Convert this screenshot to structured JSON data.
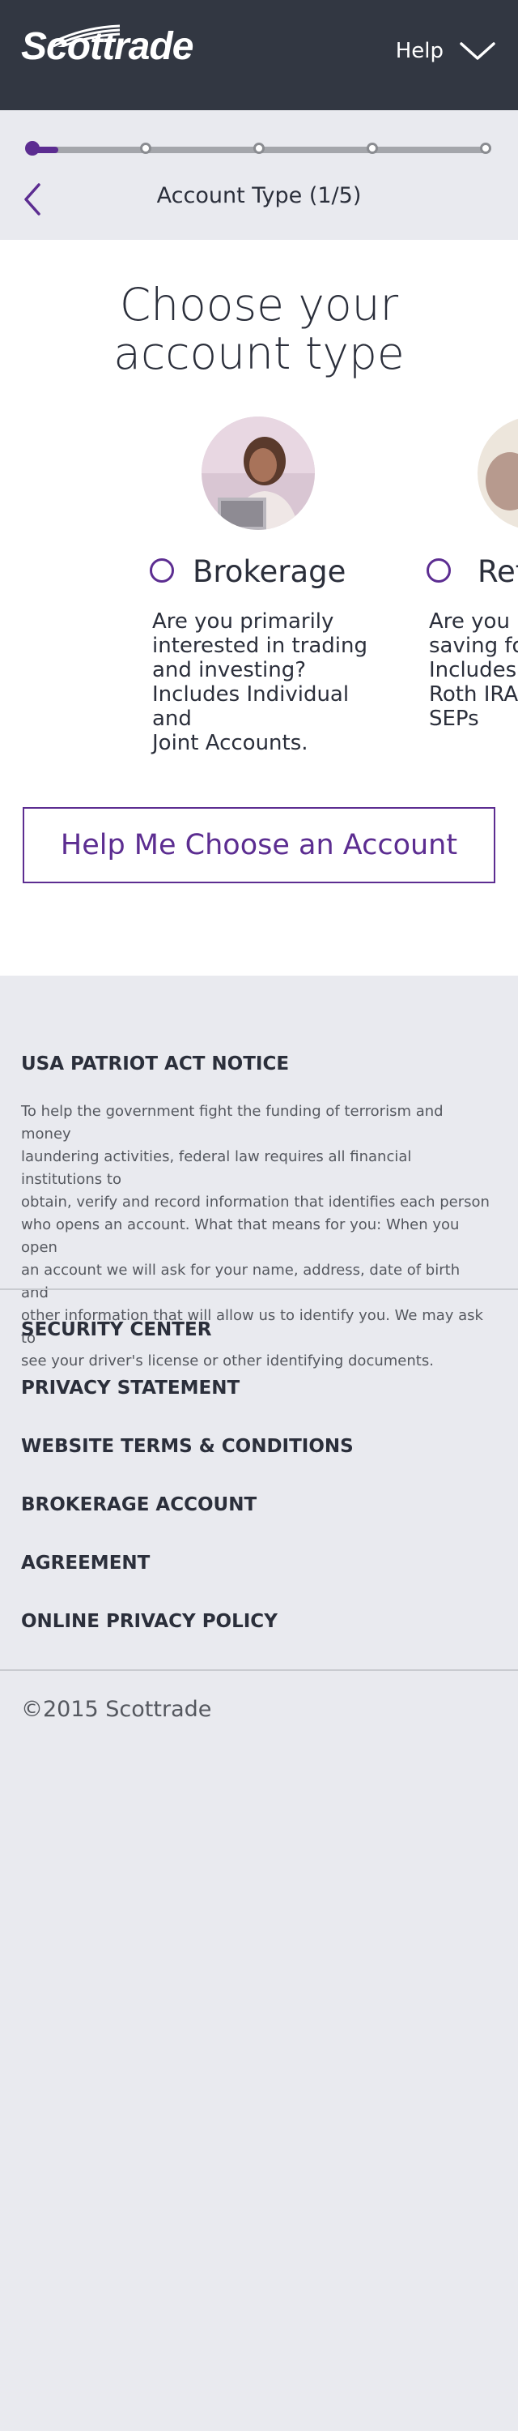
{
  "header": {
    "logo_text": "Scottrade",
    "help_label": "Help"
  },
  "progress": {
    "step_title": "Account Type (1/5)",
    "current_step": 1,
    "total_steps": 5
  },
  "main": {
    "title_line1": "Choose your",
    "title_line2": "account type",
    "cards": [
      {
        "label": "Brokerage",
        "desc_lines": [
          "Are you primarily",
          "interested in trading",
          "and investing?",
          "Includes Individual and",
          "Joint Accounts."
        ]
      },
      {
        "label": "Ret",
        "desc_lines": [
          "Are you p",
          "saving fo",
          "Includes",
          "Roth IRAs",
          "SEPs"
        ]
      }
    ],
    "choose_button": "Help Me Choose an Account"
  },
  "footer": {
    "notice_title": "USA PATRIOT ACT NOTICE",
    "notice_lines": [
      "To help the government fight the funding of terrorism and money",
      "laundering activities, federal law requires all financial institutions to",
      "obtain, verify and record information that identifies each person",
      "who opens an account. What that means for you: When you open",
      "an account we will ask for your name, address, date of birth and",
      "other information that will allow us to identify you. We may ask to",
      "see your driver's license or other identifying documents."
    ],
    "links": [
      "SECURITY CENTER",
      "PRIVACY STATEMENT",
      "WEBSITE TERMS & CONDITIONS",
      "BROKERAGE ACCOUNT",
      "AGREEMENT",
      "ONLINE PRIVACY POLICY"
    ],
    "copyright": "©2015 Scottrade"
  },
  "colors": {
    "header_bg": "#323742",
    "accent": "#5c2d91",
    "page_bg": "#e9eaef"
  },
  "icons": {
    "help": "chevron-down-icon",
    "back": "chevron-left-icon",
    "radio": "radio-unchecked-icon"
  }
}
